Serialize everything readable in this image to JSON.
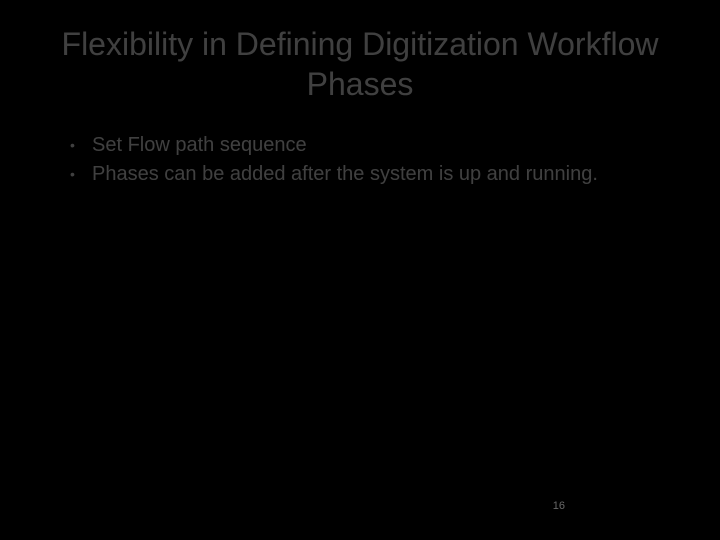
{
  "slide": {
    "title": "Flexibility in Defining Digitization Workflow Phases",
    "bullets": [
      "Set Flow path sequence",
      "Phases can be added after the system is up and running."
    ],
    "page_number": "16"
  }
}
